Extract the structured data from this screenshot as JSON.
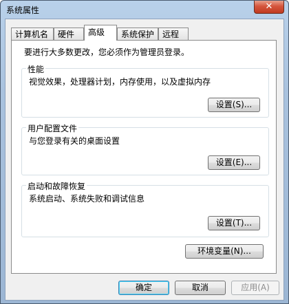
{
  "window": {
    "title": "系统属性",
    "close_label": "✕"
  },
  "tabs": [
    {
      "label": "计算机名"
    },
    {
      "label": "硬件"
    },
    {
      "label": "高级"
    },
    {
      "label": "系统保护"
    },
    {
      "label": "远程"
    }
  ],
  "active_tab": "高级",
  "notice": "要进行大多数更改，您必须作为管理员登录。",
  "groups": {
    "performance": {
      "title": "性能",
      "desc": "视觉效果，处理器计划，内存使用，以及虚拟内存",
      "button": "设置(S)..."
    },
    "profiles": {
      "title": "用户配置文件",
      "desc": "与您登录有关的桌面设置",
      "button": "设置(E)..."
    },
    "startup": {
      "title": "启动和故障恢复",
      "desc": "系统启动、系统失败和调试信息",
      "button": "设置(T)..."
    }
  },
  "env_button": "环境变量(N)...",
  "footer": {
    "ok": "确定",
    "cancel": "取消",
    "apply": "应用(A)"
  }
}
